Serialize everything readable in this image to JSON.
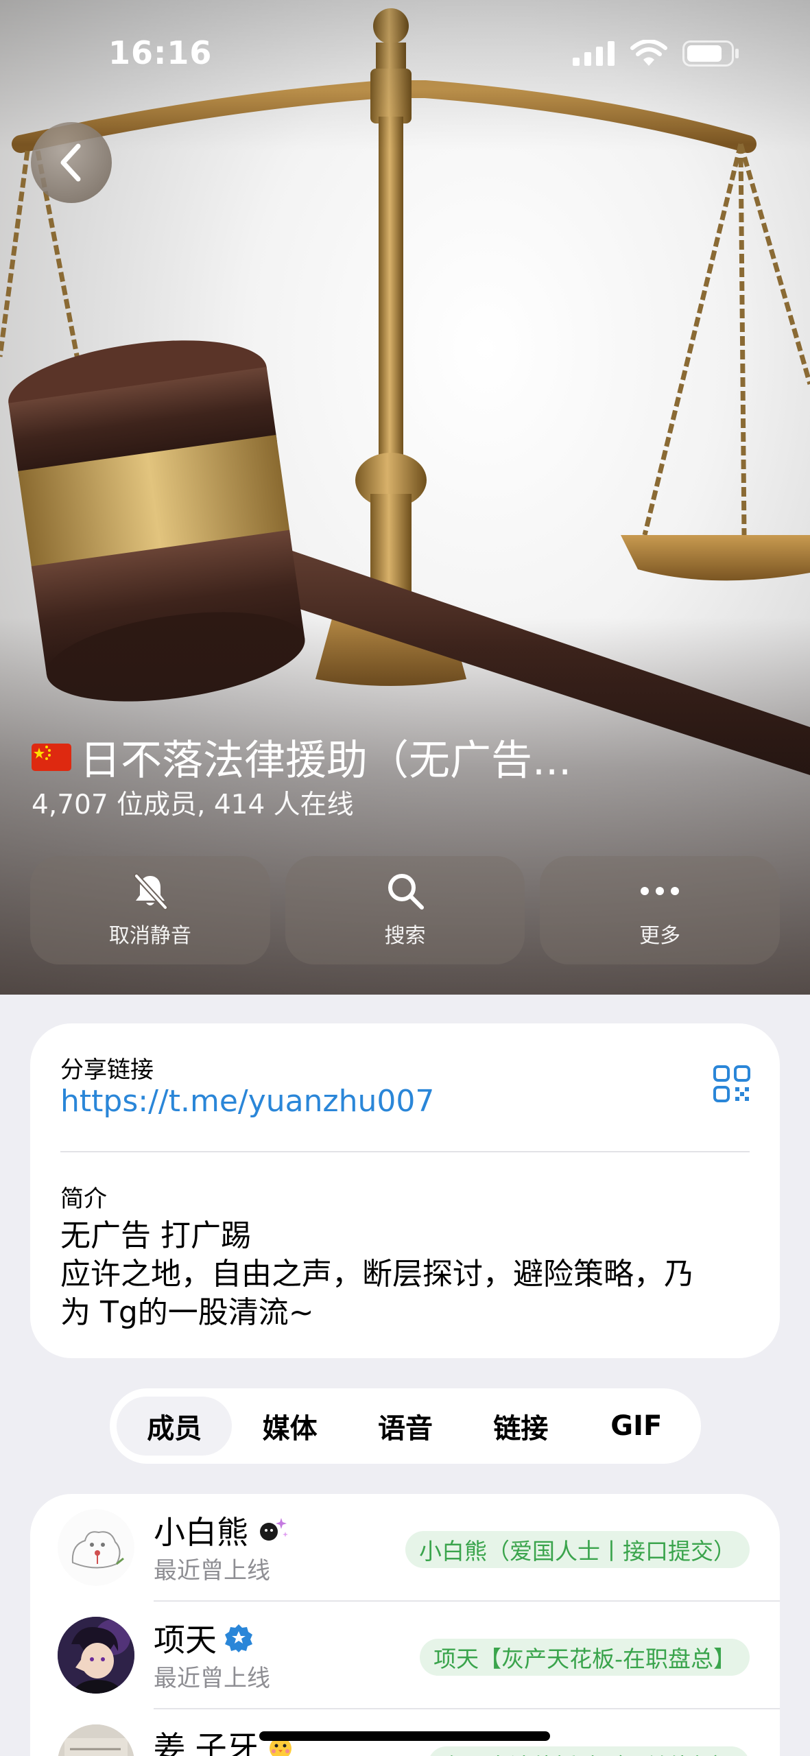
{
  "status_bar": {
    "time": "16:16"
  },
  "hero": {
    "title": "日不落法律援助（无广告...",
    "subtitle": "4,707 位成员, 414 人在线",
    "flag_icon": "china-flag-icon"
  },
  "actions": [
    {
      "label": "取消静音",
      "icon": "bell-slash-icon"
    },
    {
      "label": "搜索",
      "icon": "search-icon"
    },
    {
      "label": "更多",
      "icon": "more-icon"
    }
  ],
  "info": {
    "share_label": "分享链接",
    "share_link": "https://t.me/yuanzhu007",
    "bio_label": "简介",
    "bio_lines": [
      "无广告 打广踢",
      "应许之地，自由之声，断层探讨，避险策略，乃",
      "为 Tg的一股清流~"
    ]
  },
  "tabs": [
    {
      "label": "成员",
      "active": true
    },
    {
      "label": "媒体",
      "active": false
    },
    {
      "label": "语音",
      "active": false
    },
    {
      "label": "链接",
      "active": false
    },
    {
      "label": "GIF",
      "active": false
    }
  ],
  "members": [
    {
      "name": "小白熊",
      "status": "最近曾上线",
      "tag": "小白熊（爱国人士丨接口提交）"
    },
    {
      "name": "项天",
      "status": "最近曾上线",
      "tag": "项天【灰产天花板-在职盘总】"
    },
    {
      "name": "姜 子牙",
      "status": "",
      "tag": "东三省法律援助（公益律师）"
    }
  ],
  "colors": {
    "link": "#2a86d8",
    "tag_bg": "#e6f4e8",
    "tag_text": "#3aa44c",
    "page_bg": "#eeeef3"
  }
}
